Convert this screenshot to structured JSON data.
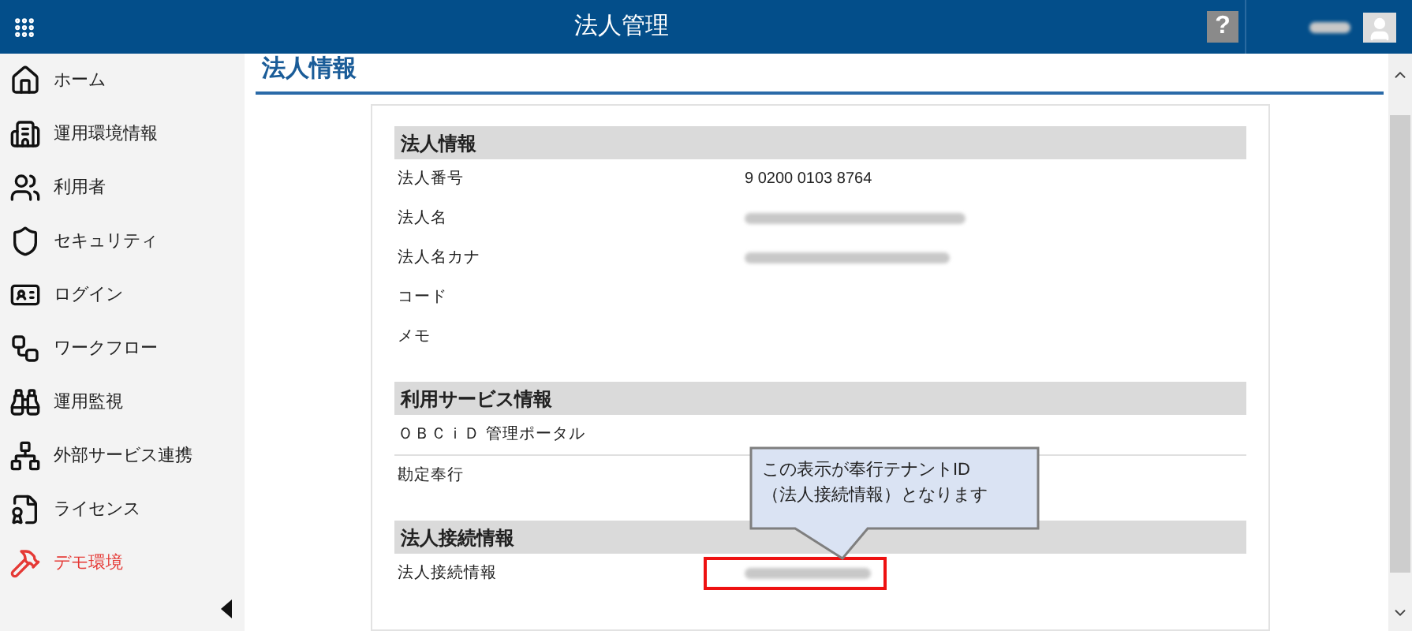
{
  "header": {
    "title": "法人管理",
    "help_label": "?"
  },
  "sidebar": {
    "items": [
      {
        "label": "ホーム",
        "color": "#222222"
      },
      {
        "label": "運用環境情報",
        "color": "#222222"
      },
      {
        "label": "利用者",
        "color": "#222222"
      },
      {
        "label": "セキュリティ",
        "color": "#222222"
      },
      {
        "label": "ログイン",
        "color": "#222222"
      },
      {
        "label": "ワークフロー",
        "color": "#222222"
      },
      {
        "label": "運用監視",
        "color": "#222222"
      },
      {
        "label": "外部サービス連携",
        "color": "#222222"
      },
      {
        "label": "ライセンス",
        "color": "#222222"
      },
      {
        "label": "デモ環境",
        "color": "#e53935"
      }
    ]
  },
  "page_title": "法人情報",
  "sections": [
    {
      "title": "法人情報",
      "rows": [
        {
          "label": "法人番号",
          "kind": "text",
          "value": "9 0200 0103 8764"
        },
        {
          "label": "法人名",
          "kind": "redacted"
        },
        {
          "label": "法人名カナ",
          "kind": "redacted"
        },
        {
          "label": "コード",
          "kind": "empty"
        },
        {
          "label": "メモ",
          "kind": "empty"
        }
      ]
    },
    {
      "title": "利用サービス情報",
      "rows": [
        {
          "label": "ＯＢＣｉＤ 管理ポータル",
          "kind": "empty",
          "divider": true
        },
        {
          "label": "勘定奉行",
          "kind": "empty"
        }
      ]
    },
    {
      "title": "法人接続情報",
      "rows": [
        {
          "label": "法人接続情報",
          "kind": "redacted",
          "highlighted": true
        }
      ]
    }
  ],
  "callout": {
    "lines": [
      "この表示が奉行テナントID",
      "（法人接続情報）となります"
    ]
  }
}
